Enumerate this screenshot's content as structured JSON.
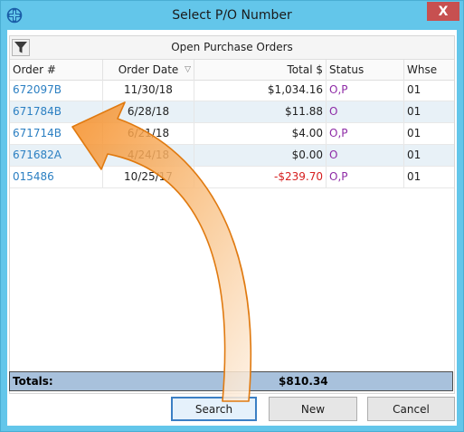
{
  "window": {
    "title": "Select P/O Number",
    "close_glyph": "X",
    "app_icon": "app-logo-icon"
  },
  "grid": {
    "title": "Open Purchase Orders",
    "filter_icon": "filter-icon",
    "columns": {
      "order": "Order #",
      "date": "Order Date",
      "total": "Total $",
      "status": "Status",
      "whse": "Whse"
    },
    "sort_indicator": "▽",
    "rows": [
      {
        "order": "672097B",
        "date": "11/30/18",
        "total": "$1,034.16",
        "status": "O,P",
        "whse": "01"
      },
      {
        "order": "671784B",
        "date": "6/28/18",
        "total": "$11.88",
        "status": "O",
        "whse": "01"
      },
      {
        "order": "671714B",
        "date": "6/21/18",
        "total": "$4.00",
        "status": "O,P",
        "whse": "01"
      },
      {
        "order": "671682A",
        "date": "4/24/18",
        "total": "$0.00",
        "status": "O",
        "whse": "01"
      },
      {
        "order": "015486",
        "date": "10/25/17",
        "total": "-$239.70",
        "status": "O,P",
        "whse": "01"
      }
    ]
  },
  "totals": {
    "label": "Totals:",
    "value": "$810.34"
  },
  "buttons": {
    "search": "Search",
    "new": "New",
    "cancel": "Cancel"
  },
  "colors": {
    "title_bar": "#63c6ea",
    "link_blue": "#2b7fc2",
    "status_purple": "#8e2ba6",
    "negative_red": "#d62020",
    "totals_bg": "#a8c1dc",
    "annotation_arrow": "#f59a32"
  },
  "annotation": {
    "icon": "curved-arrow-icon"
  }
}
